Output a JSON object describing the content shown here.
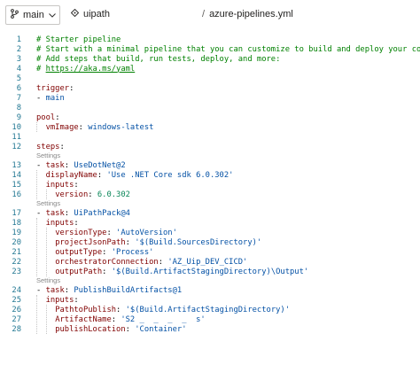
{
  "header": {
    "branch": "main",
    "repo": "uipath",
    "path_separator": "/",
    "file": "azure-pipelines.yml"
  },
  "editor": {
    "settings_label": "Settings",
    "lines": [
      {
        "n": "1",
        "text": "# Starter pipeline"
      },
      {
        "n": "2",
        "text": "# Start with a minimal pipeline that you can customize to build and deploy your code."
      },
      {
        "n": "3",
        "text": "# Add steps that build, run tests, deploy, and more:"
      },
      {
        "n": "4",
        "text": "# https://aka.ms/yaml"
      },
      {
        "n": "5",
        "text": ""
      },
      {
        "n": "6",
        "text": "trigger:"
      },
      {
        "n": "7",
        "text": "- main"
      },
      {
        "n": "8",
        "text": ""
      },
      {
        "n": "9",
        "text": "pool:"
      },
      {
        "n": "10",
        "text": "  vmImage: windows-latest"
      },
      {
        "n": "11",
        "text": ""
      },
      {
        "n": "12",
        "text": "steps:"
      },
      {
        "n": "13",
        "text": "- task: UseDotNet@2"
      },
      {
        "n": "14",
        "text": "  displayName: 'Use .NET Core sdk 6.0.302'"
      },
      {
        "n": "15",
        "text": "  inputs:"
      },
      {
        "n": "16",
        "text": "    version: 6.0.302"
      },
      {
        "n": "17",
        "text": "- task: UiPathPack@4"
      },
      {
        "n": "18",
        "text": "  inputs:"
      },
      {
        "n": "19",
        "text": "    versionType: 'AutoVersion'"
      },
      {
        "n": "20",
        "text": "    projectJsonPath: '$(Build.SourcesDirectory)'"
      },
      {
        "n": "21",
        "text": "    outputType: 'Process'"
      },
      {
        "n": "22",
        "text": "    orchestratorConnection: 'AZ_Uip_DEV_CICD'"
      },
      {
        "n": "23",
        "text": "    outputPath: '$(Build.ArtifactStagingDirectory)\\Output'"
      },
      {
        "n": "24",
        "text": "- task: PublishBuildArtifacts@1"
      },
      {
        "n": "25",
        "text": "  inputs:"
      },
      {
        "n": "26",
        "text": "    PathtoPublish: '$(Build.ArtifactStagingDirectory)'"
      },
      {
        "n": "27",
        "text": "    ArtifactName: 'S2 _  _  _  _  s'"
      },
      {
        "n": "28",
        "text": "    publishLocation: 'Container'"
      }
    ]
  }
}
